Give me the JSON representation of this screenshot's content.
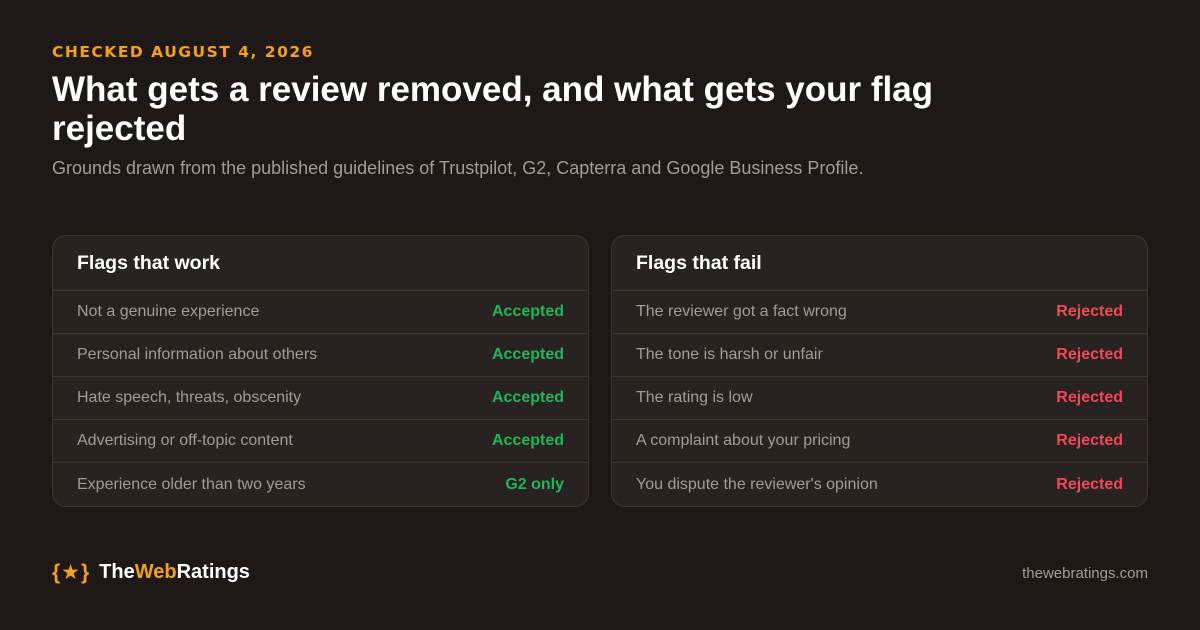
{
  "header": {
    "eyebrow": "CHECKED AUGUST 4, 2026",
    "title": "What gets a review removed, and what gets your flag rejected",
    "subtitle": "Grounds drawn from the published guidelines of Trustpilot, G2, Capterra and Google Business Profile."
  },
  "cards": {
    "work": {
      "title": "Flags that work",
      "rows": [
        {
          "label": "Not a genuine experience",
          "status": "Accepted"
        },
        {
          "label": "Personal information about others",
          "status": "Accepted"
        },
        {
          "label": "Hate speech, threats, obscenity",
          "status": "Accepted"
        },
        {
          "label": "Advertising or off-topic content",
          "status": "Accepted"
        },
        {
          "label": "Experience older than two years",
          "status": "G2 only"
        }
      ]
    },
    "fail": {
      "title": "Flags that fail",
      "rows": [
        {
          "label": "The reviewer got a fact wrong",
          "status": "Rejected"
        },
        {
          "label": "The tone is harsh or unfair",
          "status": "Rejected"
        },
        {
          "label": "The rating is low",
          "status": "Rejected"
        },
        {
          "label": "A complaint about your pricing",
          "status": "Rejected"
        },
        {
          "label": "You dispute the reviewer's opinion",
          "status": "Rejected"
        }
      ]
    }
  },
  "footer": {
    "brand_mark": "{★}",
    "brand_part1": "The",
    "brand_part2": "Web",
    "brand_part3": "Ratings",
    "domain": "thewebratings.com"
  },
  "colors": {
    "background": "#1e1917",
    "accent": "#f5a01a",
    "accepted": "#21b55c",
    "rejected": "#f0485a"
  }
}
